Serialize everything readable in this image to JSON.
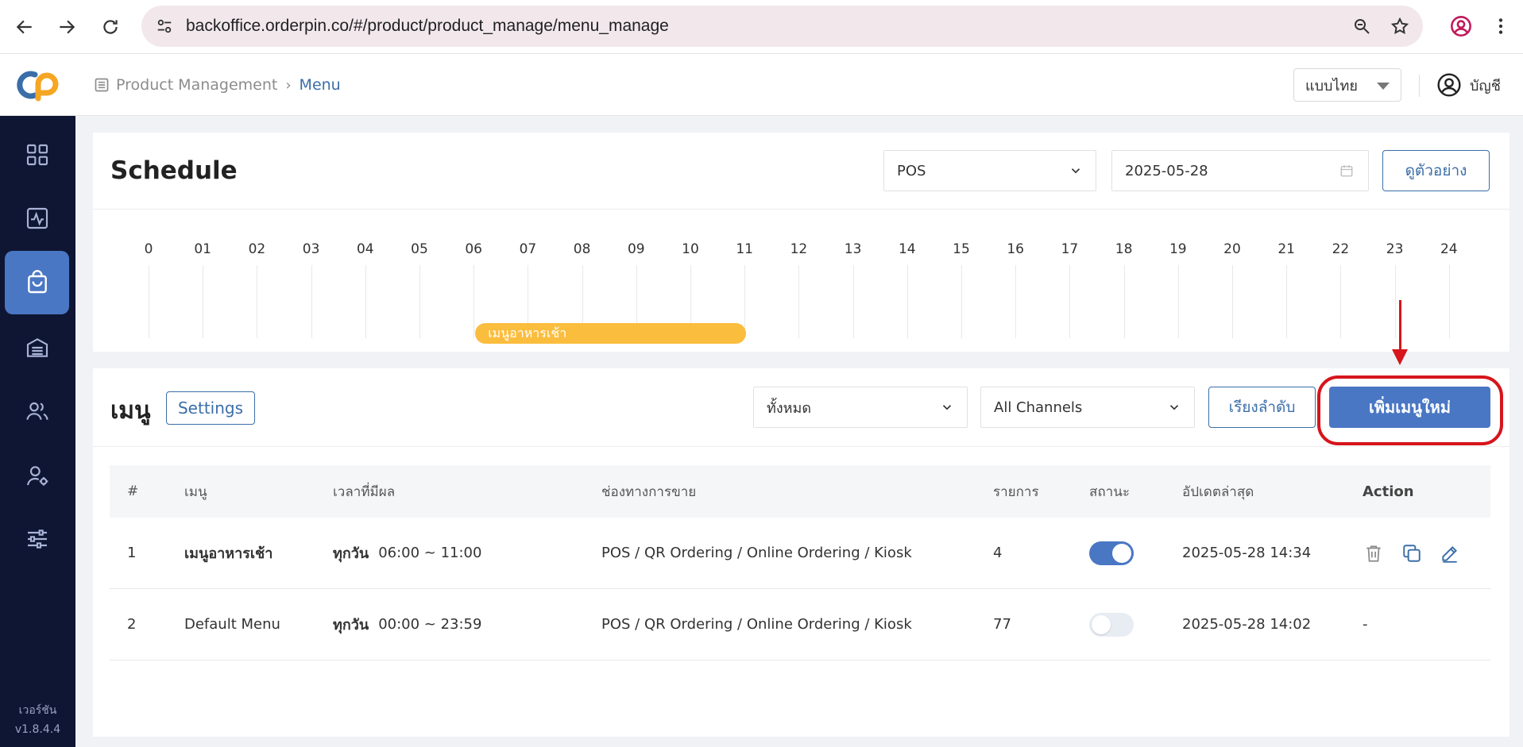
{
  "browser": {
    "url": "backoffice.orderpin.co/#/product/product_manage/menu_manage"
  },
  "header": {
    "breadcrumb_parent": "Product Management",
    "breadcrumb_current": "Menu",
    "language": "แบบไทย",
    "account_label": "บัญชี"
  },
  "sidebar": {
    "items": [
      {
        "icon": "dashboard-grid-icon"
      },
      {
        "icon": "analytics-icon"
      },
      {
        "icon": "shopping-bag-icon",
        "active": true
      },
      {
        "icon": "inventory-icon"
      },
      {
        "icon": "users-icon"
      },
      {
        "icon": "user-settings-icon"
      },
      {
        "icon": "sliders-icon"
      }
    ],
    "version_label": "เวอร์ชัน",
    "version": "v1.8.4.4"
  },
  "schedule": {
    "title": "Schedule",
    "channel": "POS",
    "date": "2025-05-28",
    "preview_label": "ดูตัวอย่าง",
    "hours": [
      "0",
      "01",
      "02",
      "03",
      "04",
      "05",
      "06",
      "07",
      "08",
      "09",
      "10",
      "11",
      "12",
      "13",
      "14",
      "15",
      "16",
      "17",
      "18",
      "19",
      "20",
      "21",
      "22",
      "23",
      "24"
    ],
    "bars": [
      {
        "label": "เมนูอาหารเช้า",
        "start": 6,
        "end": 11,
        "color": "#fbbd3d"
      }
    ]
  },
  "menu": {
    "title": "เมนู",
    "settings_label": "Settings",
    "filter_all": "ทั้งหมด",
    "filter_channels": "All Channels",
    "sort_label": "เรียงลำดับ",
    "add_label": "เพิ่มเมนูใหม่",
    "columns": {
      "index": "#",
      "name": "เมนู",
      "time": "เวลาที่มีผล",
      "channels": "ช่องทางการขาย",
      "items": "รายการ",
      "status": "สถานะ",
      "updated": "อัปเดตล่าสุด",
      "action": "Action"
    },
    "rows": [
      {
        "index": "1",
        "name": "เมนูอาหารเช้า",
        "day": "ทุกวัน",
        "time": "06:00 ~ 11:00",
        "channels": "POS / QR Ordering / Online Ordering / Kiosk",
        "items": "4",
        "status": true,
        "updated": "2025-05-28 14:34",
        "action": ""
      },
      {
        "index": "2",
        "name": "Default Menu",
        "day": "ทุกวัน",
        "time": "00:00 ~ 23:59",
        "channels": "POS / QR Ordering / Online Ordering / Kiosk",
        "items": "77",
        "status": false,
        "updated": "2025-05-28 14:02",
        "action": "-"
      }
    ]
  },
  "colors": {
    "primary": "#4a77c4",
    "sidebar": "#0f1633",
    "highlight": "#d6151c",
    "schedule_bar": "#fbbd3d"
  }
}
